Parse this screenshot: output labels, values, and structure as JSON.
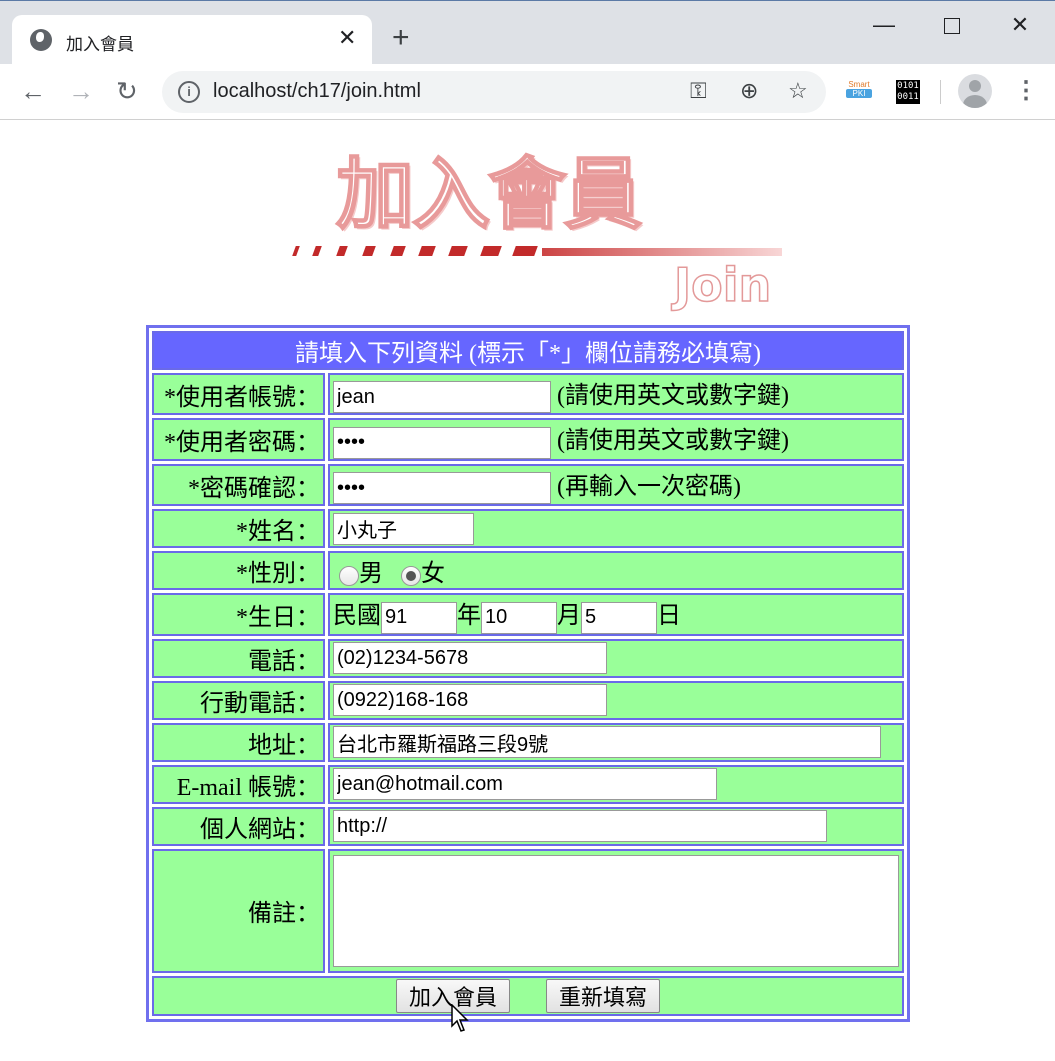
{
  "browser": {
    "tab_title": "加入會員",
    "url": "localhost/ch17/join.html",
    "new_tab": "+",
    "close": "✕"
  },
  "banner": {
    "title": "加入會員",
    "subtitle": "Join"
  },
  "form": {
    "header": "請填入下列資料 (標示「*」欄位請務必填寫)",
    "username": {
      "label": "*使用者帳號：",
      "value": "jean",
      "hint": "(請使用英文或數字鍵)"
    },
    "password": {
      "label": "*使用者密碼：",
      "value": "••••",
      "hint": "(請使用英文或數字鍵)"
    },
    "confirm": {
      "label": "*密碼確認：",
      "value": "••••",
      "hint": "(再輸入一次密碼)"
    },
    "name": {
      "label": "*姓名：",
      "value": "小丸子"
    },
    "gender": {
      "label": "*性別：",
      "male": "男",
      "female": "女",
      "selected": "女"
    },
    "birthday": {
      "label": "*生日：",
      "era": "民國",
      "year": "91",
      "year_unit": "年",
      "month": "10",
      "month_unit": "月",
      "day": "5",
      "day_unit": "日"
    },
    "phone": {
      "label": "電話：",
      "value": "(02)1234-5678"
    },
    "mobile": {
      "label": "行動電話：",
      "value": "(0922)168-168"
    },
    "address": {
      "label": "地址：",
      "value": "台北市羅斯福路三段9號"
    },
    "email": {
      "label": "E-mail 帳號：",
      "value": "jean@hotmail.com"
    },
    "website": {
      "label": "個人網站：",
      "value": "http://"
    },
    "memo": {
      "label": "備註：",
      "value": ""
    },
    "submit_label": "加入會員",
    "reset_label": "重新填寫"
  }
}
